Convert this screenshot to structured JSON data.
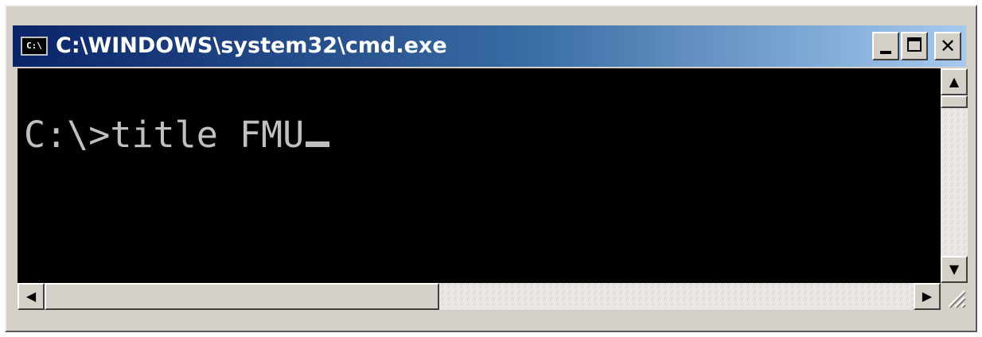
{
  "window": {
    "title": "C:\\WINDOWS\\system32\\cmd.exe",
    "app_icon": {
      "name": "console-icon",
      "text": "C:\\"
    },
    "buttons": {
      "minimize": {
        "icon": "minimize-icon"
      },
      "maximize": {
        "icon": "maximize-icon"
      },
      "close": {
        "icon": "close-icon",
        "glyph": "✕"
      }
    }
  },
  "console": {
    "background": "#000000",
    "foreground": "#c0c0c0",
    "lines": [
      {
        "prompt": "C:\\>",
        "command": "title FMU"
      }
    ],
    "cursor": "underscore"
  },
  "scrollbars": {
    "vertical": {
      "up_icon": "up-arrow-icon",
      "up_glyph": "▲",
      "down_icon": "down-arrow-icon",
      "down_glyph": "▼"
    },
    "horizontal": {
      "left_icon": "left-arrow-icon",
      "left_glyph": "◀",
      "right_icon": "right-arrow-icon",
      "right_glyph": "▶"
    }
  },
  "colors": {
    "titlebar_start": "#0a246a",
    "titlebar_end": "#a6caf0",
    "face": "#d4d0c8"
  }
}
